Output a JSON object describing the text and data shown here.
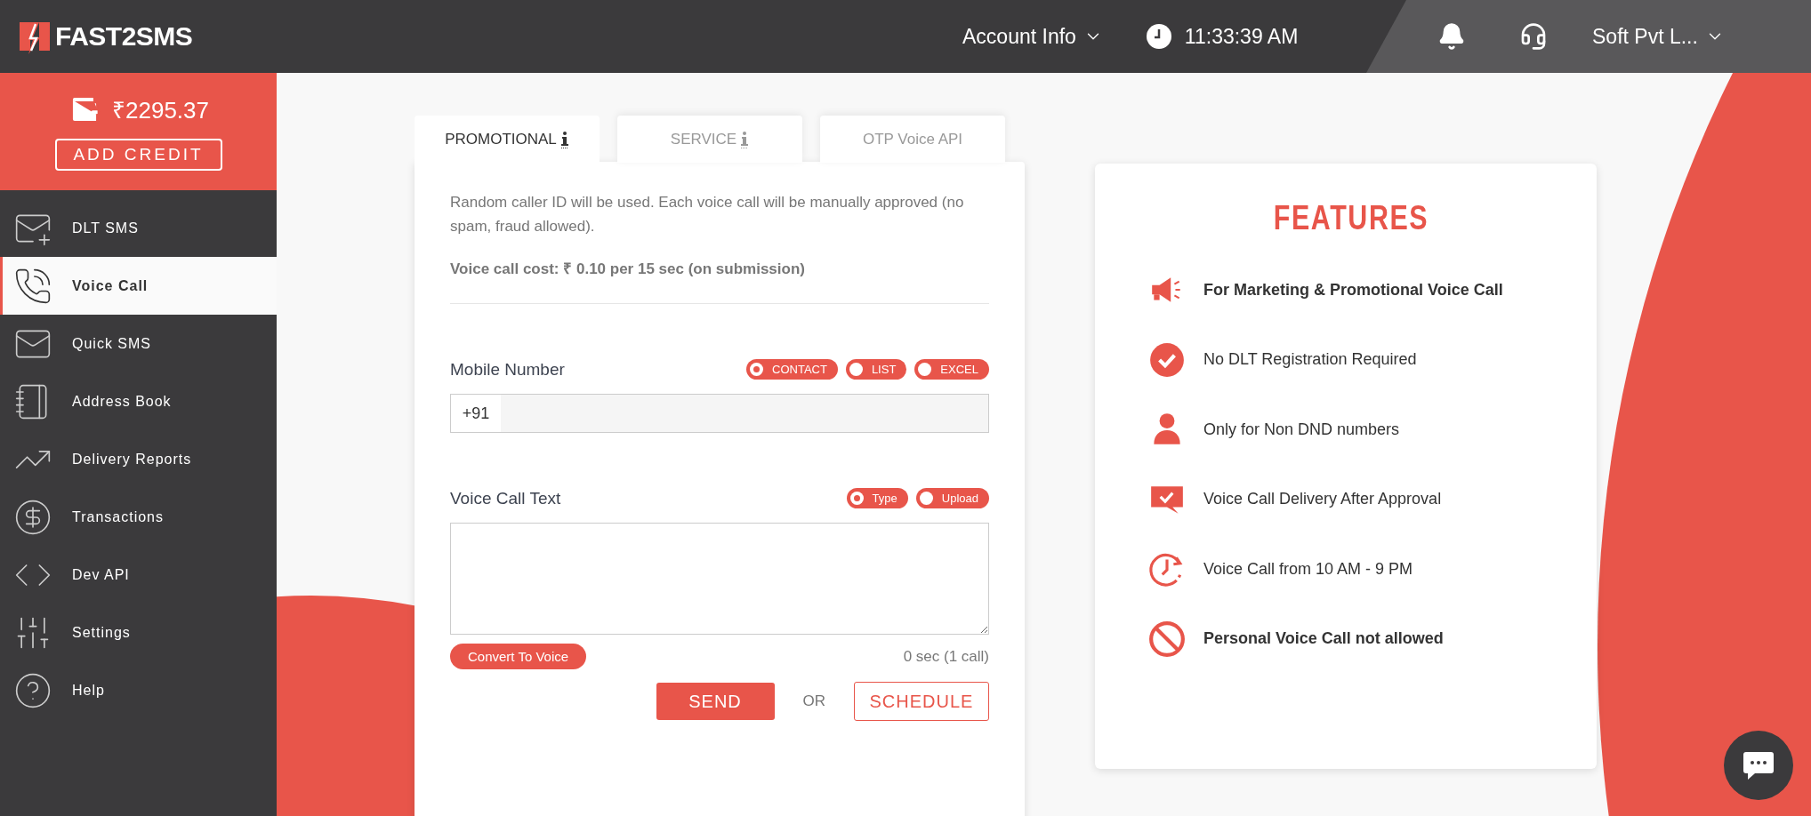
{
  "header": {
    "logo": "FAST2SMS",
    "account_menu": "Account Info",
    "time": "11:33:39 AM",
    "user_menu": "Soft Pvt L..."
  },
  "wallet": {
    "balance": "₹2295.37",
    "add_credit": "ADD CREDIT"
  },
  "sidebar": {
    "items": [
      {
        "label": "DLT SMS",
        "selected": false
      },
      {
        "label": "Voice Call",
        "selected": true
      },
      {
        "label": "Quick SMS",
        "selected": false
      },
      {
        "label": "Address Book",
        "selected": false
      },
      {
        "label": "Delivery Reports",
        "selected": false
      },
      {
        "label": "Transactions",
        "selected": false
      },
      {
        "label": "Dev API",
        "selected": false
      },
      {
        "label": "Settings",
        "selected": false
      },
      {
        "label": "Help",
        "selected": false
      }
    ]
  },
  "tabs": [
    {
      "label": "PROMOTIONAL",
      "selected": true,
      "info": true
    },
    {
      "label": "SERVICE",
      "selected": false,
      "info": true
    },
    {
      "label": "OTP Voice API",
      "selected": false,
      "info": false
    }
  ],
  "description": "Random caller ID will be used. Each voice call will be manually approved (no spam, fraud allowed).",
  "cost": "Voice call cost: ₹ 0.10 per 15 sec (on submission)",
  "mobile": {
    "label": "Mobile Number",
    "options": [
      {
        "label": "CONTACT",
        "selected": true
      },
      {
        "label": "LIST",
        "selected": false
      },
      {
        "label": "EXCEL",
        "selected": false
      }
    ],
    "prefix": "+91"
  },
  "voice_text": {
    "label": "Voice Call Text",
    "options": [
      {
        "label": "Type",
        "selected": true
      },
      {
        "label": "Upload",
        "selected": false
      }
    ],
    "convert": "Convert To Voice",
    "duration": "0 sec (1 call)"
  },
  "actions": {
    "send": "SEND",
    "or": "OR",
    "schedule": "SCHEDULE"
  },
  "features": {
    "title": "FEATURES",
    "items": [
      {
        "kind": "megaphone",
        "text": "For Marketing & Promotional Voice Call",
        "bold": true
      },
      {
        "kind": "check",
        "text": "No DLT Registration Required",
        "bold": false
      },
      {
        "kind": "user",
        "text": "Only for Non DND numbers",
        "bold": false
      },
      {
        "kind": "chat",
        "text": "Voice Call Delivery After Approval",
        "bold": false
      },
      {
        "kind": "clock",
        "text": "Voice Call from 10 AM - 9 PM",
        "bold": false
      },
      {
        "kind": "ban",
        "text": "Personal Voice Call not allowed",
        "bold": true
      }
    ]
  }
}
